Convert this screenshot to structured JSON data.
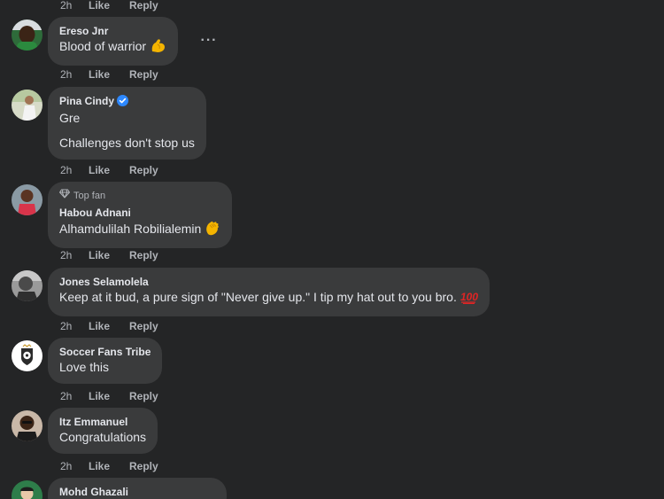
{
  "colors": {
    "background": "#242526",
    "bubble": "#3a3b3c",
    "primary_text": "#e4e6eb",
    "secondary_text": "#b0b3b8",
    "verified": "#2d88ff"
  },
  "top_actions": {
    "time": "2h",
    "like": "Like",
    "reply": "Reply"
  },
  "comments": [
    {
      "author": "Ereso Jnr",
      "lines": [
        "Blood of warrior"
      ],
      "emoji": "flexed-biceps",
      "time": "2h",
      "like": "Like",
      "reply": "Reply",
      "more_icon": "more-horizontal-icon"
    },
    {
      "author": "Pina Cindy",
      "verified_icon": "verified-badge-icon",
      "lines": [
        "Gre",
        "Challenges don't stop us"
      ],
      "time": "2h",
      "like": "Like",
      "reply": "Reply"
    },
    {
      "badge": "Top fan",
      "badge_icon": "diamond-icon",
      "author": "Habou Adnani",
      "lines": [
        "Alhamdulilah Robilialemin"
      ],
      "emoji": "clapping-hands",
      "time": "2h",
      "like": "Like",
      "reply": "Reply"
    },
    {
      "author": "Jones Selamolela",
      "lines": [
        "Keep at it bud, a pure sign of \"Never give up.\" I tip my hat out to you bro."
      ],
      "emoji": "hundred-points",
      "time": "2h",
      "like": "Like",
      "reply": "Reply"
    },
    {
      "author": "Soccer Fans Tribe",
      "lines": [
        "Love this"
      ],
      "time": "2h",
      "like": "Like",
      "reply": "Reply"
    },
    {
      "author": "Itz Emmanuel",
      "lines": [
        "Congratulations"
      ],
      "time": "2h",
      "like": "Like",
      "reply": "Reply"
    },
    {
      "author": "Mohd Ghazali",
      "lines": []
    }
  ]
}
